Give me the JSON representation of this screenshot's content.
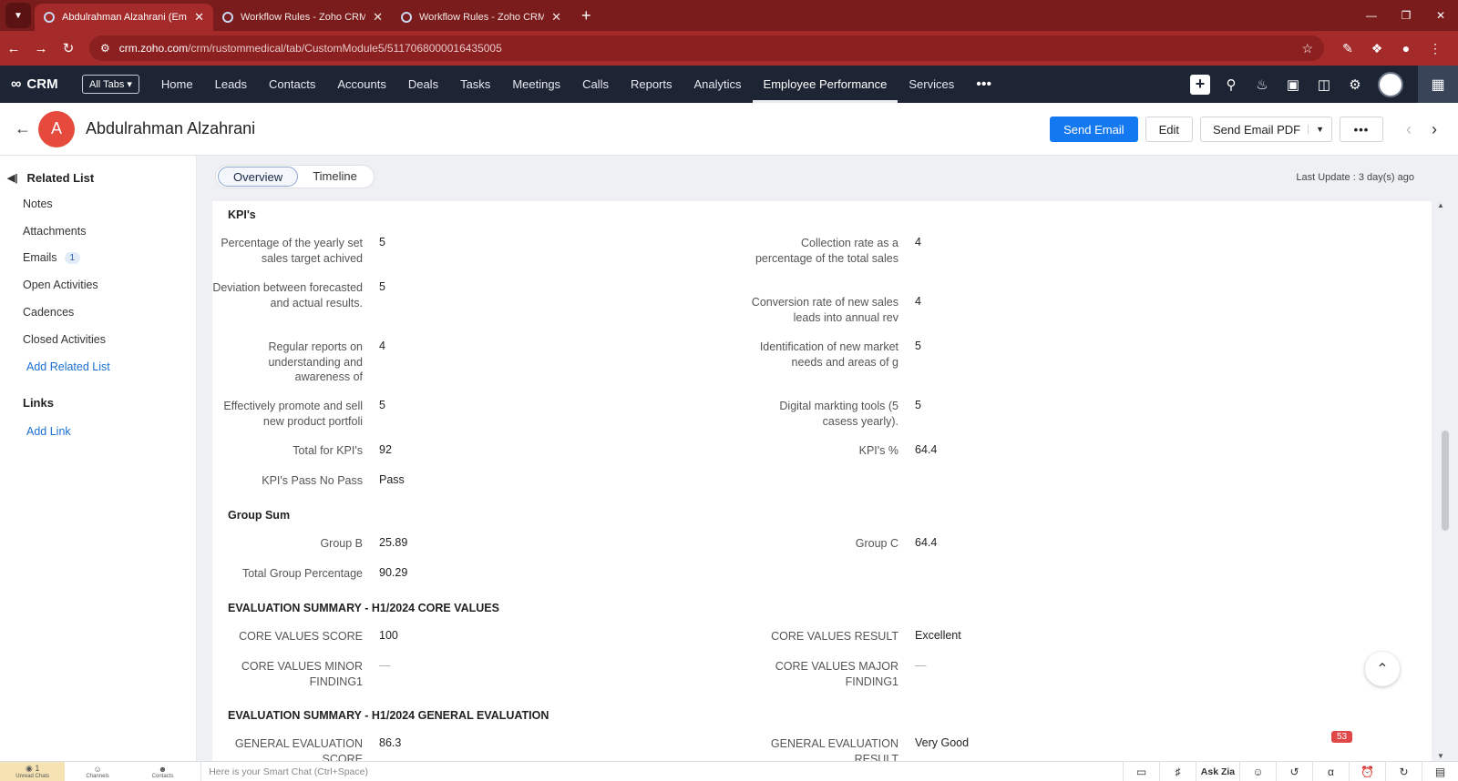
{
  "browser": {
    "tabs": [
      {
        "title": "Abdulrahman Alzahrani (Emplo",
        "active": true
      },
      {
        "title": "Workflow Rules - Zoho CRM",
        "active": false
      },
      {
        "title": "Workflow Rules - Zoho CRM",
        "active": false
      }
    ],
    "url_host": "crm.zoho.com",
    "url_path": "/crm/rustommedical/tab/CustomModule5/5117068000016435005"
  },
  "crm_nav": {
    "logo": "CRM",
    "all_tabs": "All Tabs",
    "items": [
      "Home",
      "Leads",
      "Contacts",
      "Accounts",
      "Deals",
      "Tasks",
      "Meetings",
      "Calls",
      "Reports",
      "Analytics",
      "Employee Performance",
      "Services"
    ],
    "active": "Employee Performance"
  },
  "record": {
    "initial": "A",
    "name": "Abdulrahman Alzahrani",
    "buttons": {
      "send_email": "Send Email",
      "edit": "Edit",
      "send_email_pdf": "Send Email PDF"
    }
  },
  "sidebar": {
    "related_list_title": "Related List",
    "items": [
      {
        "label": "Notes"
      },
      {
        "label": "Attachments"
      },
      {
        "label": "Emails",
        "badge": "1"
      },
      {
        "label": "Open Activities"
      },
      {
        "label": "Cadences"
      },
      {
        "label": "Closed Activities"
      }
    ],
    "add_related_list": "Add Related List",
    "links_title": "Links",
    "add_link": "Add Link"
  },
  "view": {
    "tabs": [
      "Overview",
      "Timeline"
    ],
    "active_tab": "Overview",
    "last_update": "Last Update : 3 day(s) ago"
  },
  "sections": {
    "kpis": {
      "title": "KPI's",
      "fields": [
        {
          "label": "Percentage of the yearly set sales target achived",
          "value": "5"
        },
        {
          "label": "Collection rate as a percentage of the total sales",
          "value": "4"
        },
        {
          "label": "Deviation between forecasted and actual results.",
          "value": "5"
        },
        {
          "label": "Conversion rate of new sales leads into annual rev",
          "value": "4"
        },
        {
          "label": "Regular reports on understanding and awareness of",
          "value": "4"
        },
        {
          "label": "Identification of new market needs and areas of g",
          "value": "5"
        },
        {
          "label": "Effectively promote and sell new product portfoli",
          "value": "5"
        },
        {
          "label": "Digital markting tools (5 casess yearly).",
          "value": "5"
        },
        {
          "label": "Total for KPI's",
          "value": "92"
        },
        {
          "label": "KPI's %",
          "value": "64.4"
        },
        {
          "label": "KPI's Pass No Pass",
          "value": "Pass"
        }
      ]
    },
    "group_sum": {
      "title": "Group Sum",
      "fields": [
        {
          "label": "Group B",
          "value": "25.89"
        },
        {
          "label": "Group C",
          "value": "64.4"
        },
        {
          "label": "Total Group Percentage",
          "value": "90.29"
        }
      ]
    },
    "core_values": {
      "title": "EVALUATION SUMMARY - H1/2024 CORE VALUES",
      "fields": [
        {
          "label": "CORE VALUES SCORE",
          "value": "100"
        },
        {
          "label": "CORE VALUES RESULT",
          "value": "Excellent"
        },
        {
          "label": "CORE VALUES MINOR FINDING1",
          "value": "—"
        },
        {
          "label": "CORE VALUES MAJOR FINDING1",
          "value": "—"
        }
      ]
    },
    "general_eval": {
      "title": "EVALUATION SUMMARY - H1/2024 GENERAL EVALUATION",
      "fields": [
        {
          "label": "GENERAL EVALUATION SCORE",
          "value": "86.3"
        },
        {
          "label": "GENERAL EVALUATION RESULT",
          "value": "Very Good"
        }
      ]
    }
  },
  "notification_count": "53",
  "bottom_bar": {
    "tabs": [
      "Unread Chats",
      "Channels",
      "Contacts"
    ],
    "unread_badge": "1",
    "smart_chat_placeholder": "Here is your Smart Chat (Ctrl+Space)",
    "ask_zia": "Ask Zia"
  },
  "colors": {
    "browser_frame": "#a52a2a",
    "crm_nav": "#1d2433",
    "primary_button": "#1478f0",
    "avatar": "#e64a3c"
  }
}
